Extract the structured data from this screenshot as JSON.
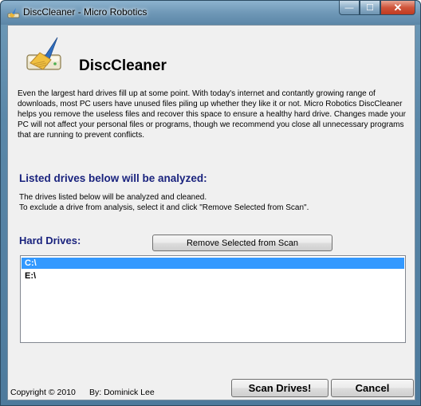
{
  "window": {
    "title": "DiscCleaner - Micro Robotics",
    "minimize_glyph": "—",
    "maximize_glyph": "☐",
    "close_glyph": "✕"
  },
  "header": {
    "app_name": "DiscCleaner",
    "logo_icon": "broom-drive-icon"
  },
  "description": "Even the largest hard drives fill up at some point. With today's internet and contantly growing range of downloads, most PC users have unused files piling up whether they like it or not. Micro Robotics DiscCleaner helps you remove the useless files and recover this space to ensure a healthy hard drive. Changes made your PC will not affect your personal files or programs, though we recommend you close all unnecessary programs that are running to prevent conflicts.",
  "analysis": {
    "heading": "Listed drives below will be analyzed:",
    "line1": "The drives listed below will be analyzed and cleaned.",
    "line2": "To exclude a drive from analysis, select it and click \"Remove Selected from Scan\"."
  },
  "drives": {
    "label": "Hard Drives:",
    "remove_button": "Remove Selected from Scan",
    "items": [
      {
        "label": "C:\\",
        "selected": true
      },
      {
        "label": "E:\\",
        "selected": false
      }
    ]
  },
  "footer": {
    "copyright": "Copyright © 2010",
    "author": "By: Dominick Lee",
    "scan_button": "Scan Drives!",
    "cancel_button": "Cancel"
  },
  "colors": {
    "heading": "#1a237e",
    "selection": "#3399ff"
  }
}
